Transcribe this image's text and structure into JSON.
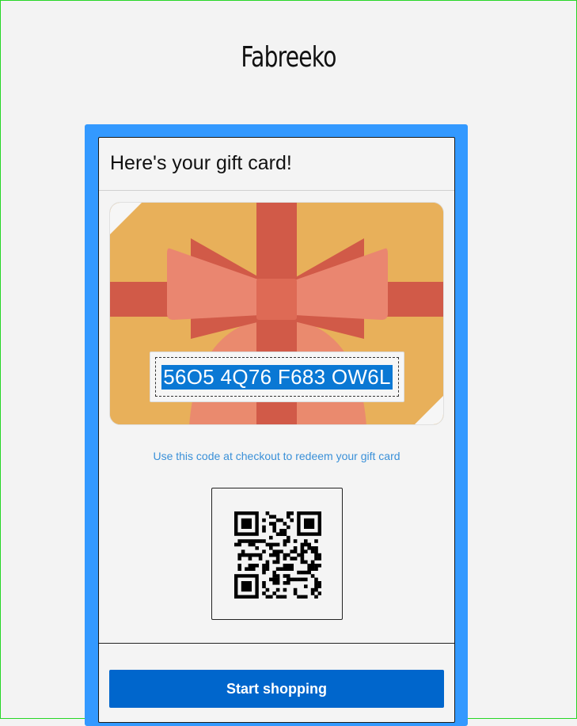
{
  "brand": {
    "name": "Fabreeko"
  },
  "card": {
    "title": "Here's your gift card!",
    "gift_code": "56O5 4Q76 F683 OW6L",
    "instruction": "Use this code at checkout to redeem your gift card",
    "cta_label": "Start shopping"
  },
  "colors": {
    "accent_blue": "#3399ff",
    "button_blue": "#0066cc",
    "gift_background": "#e8b05a",
    "ribbon": "#d15a48",
    "bow": "#ea8670",
    "link_blue": "#3a90d8",
    "code_highlight": "#0a78d4"
  },
  "icons": {
    "gift": "gift-illustration",
    "qr": "qr-code"
  }
}
